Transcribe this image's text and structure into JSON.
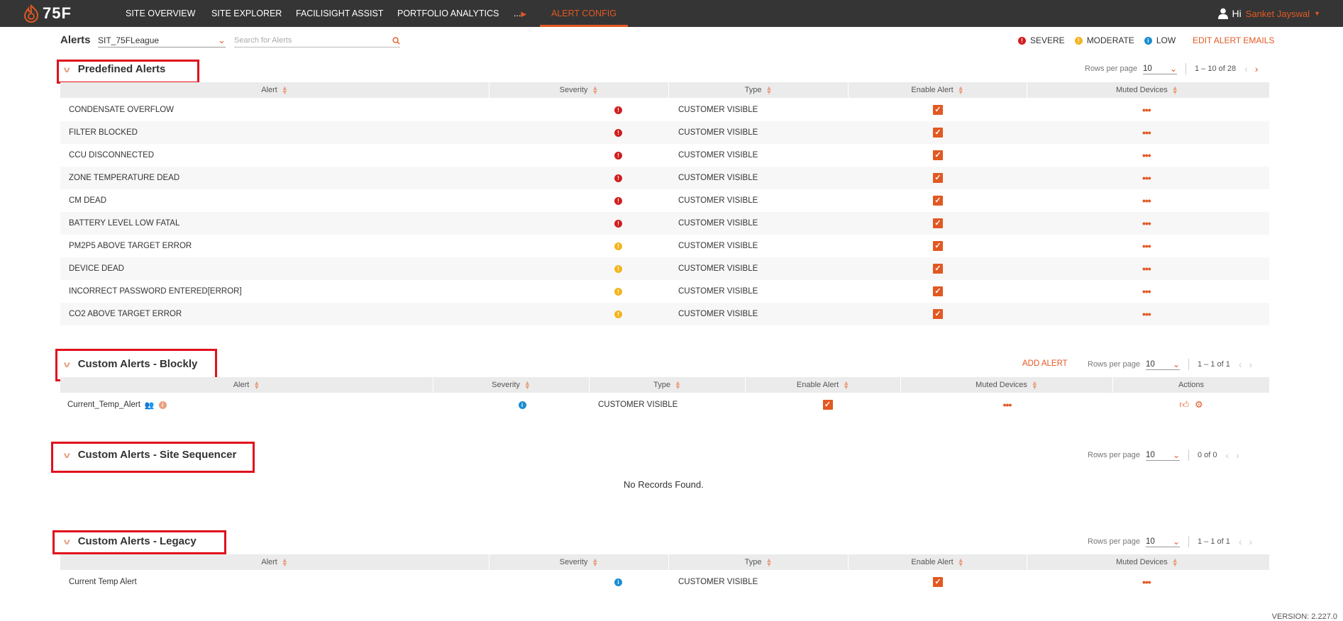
{
  "nav": {
    "logo": "75F",
    "items": [
      "SITE OVERVIEW",
      "SITE EXPLORER",
      "FACILISIGHT ASSIST",
      "PORTFOLIO ANALYTICS",
      "...",
      "ALERT CONFIG"
    ],
    "greeting": "Hi",
    "user_name": "Sanket Jayswal"
  },
  "toolbar": {
    "title": "Alerts",
    "site": "SIT_75FLeague",
    "search_placeholder": "Search for Alerts",
    "legend": [
      "SEVERE",
      "MODERATE",
      "LOW"
    ],
    "edit_emails": "EDIT ALERT EMAILS"
  },
  "predefined": {
    "title": "Predefined Alerts",
    "rows_per_page_label": "Rows per page",
    "rows_per_page": "10",
    "range": "1 – 10 of 28",
    "columns": [
      "Alert",
      "Severity",
      "Type",
      "Enable Alert",
      "Muted Devices"
    ],
    "rows": [
      {
        "name": "CONDENSATE OVERFLOW",
        "severity": "severe",
        "type": "CUSTOMER VISIBLE"
      },
      {
        "name": "FILTER BLOCKED",
        "severity": "severe",
        "type": "CUSTOMER VISIBLE"
      },
      {
        "name": "CCU DISCONNECTED",
        "severity": "severe",
        "type": "CUSTOMER VISIBLE"
      },
      {
        "name": "ZONE TEMPERATURE DEAD",
        "severity": "severe",
        "type": "CUSTOMER VISIBLE"
      },
      {
        "name": "CM DEAD",
        "severity": "severe",
        "type": "CUSTOMER VISIBLE"
      },
      {
        "name": "BATTERY LEVEL LOW FATAL",
        "severity": "severe",
        "type": "CUSTOMER VISIBLE"
      },
      {
        "name": "PM2P5 ABOVE TARGET ERROR",
        "severity": "moderate",
        "type": "CUSTOMER VISIBLE"
      },
      {
        "name": "DEVICE DEAD",
        "severity": "moderate",
        "type": "CUSTOMER VISIBLE"
      },
      {
        "name": "INCORRECT PASSWORD ENTERED[ERROR]",
        "severity": "moderate",
        "type": "CUSTOMER VISIBLE"
      },
      {
        "name": "CO2 ABOVE TARGET ERROR",
        "severity": "moderate",
        "type": "CUSTOMER VISIBLE"
      }
    ]
  },
  "blockly": {
    "title": "Custom Alerts - Blockly",
    "add_alert": "ADD ALERT",
    "rows_per_page_label": "Rows per page",
    "rows_per_page": "10",
    "range": "1 – 1 of 1",
    "columns": [
      "Alert",
      "Severity",
      "Type",
      "Enable Alert",
      "Muted Devices",
      "Actions"
    ],
    "rows": [
      {
        "name": "Current_Temp_Alert",
        "severity": "low",
        "type": "CUSTOMER VISIBLE"
      }
    ]
  },
  "sequencer": {
    "title": "Custom Alerts - Site Sequencer",
    "rows_per_page_label": "Rows per page",
    "rows_per_page": "10",
    "range": "0 of 0",
    "empty": "No Records Found."
  },
  "legacy": {
    "title": "Custom Alerts - Legacy",
    "rows_per_page_label": "Rows per page",
    "rows_per_page": "10",
    "range": "1 – 1 of 1",
    "columns": [
      "Alert",
      "Severity",
      "Type",
      "Enable Alert",
      "Muted Devices"
    ],
    "rows": [
      {
        "name": "Current Temp Alert",
        "severity": "low",
        "type": "CUSTOMER VISIBLE"
      }
    ]
  },
  "version": "VERSION: 2.227.0",
  "colors": {
    "accent": "#e25822",
    "nav_bg": "#353535",
    "severe": "#d01f1f",
    "moderate": "#f3b51f",
    "low": "#1b8dd0",
    "highlight_box": "#e1101c"
  }
}
